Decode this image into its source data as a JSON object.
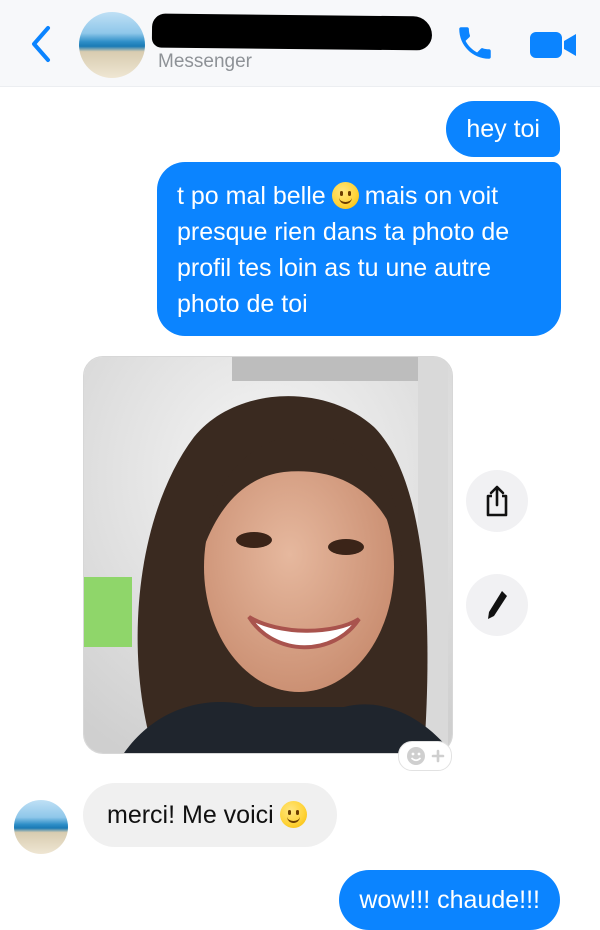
{
  "header": {
    "contact_name": "",
    "subtitle": "Messenger",
    "icons": [
      "chevron-left-icon",
      "phone-icon",
      "video-camera-icon"
    ]
  },
  "messages": [
    {
      "side": "outgoing",
      "text": "hey toi"
    },
    {
      "side": "outgoing",
      "parts": [
        "t po mal belle",
        "mais on voit presque rien dans ta photo de profil tes loin as tu une autre photo de toi"
      ]
    },
    {
      "side": "incoming",
      "type": "image"
    },
    {
      "side": "incoming",
      "text": "merci! Me voici"
    },
    {
      "side": "outgoing",
      "text": "wow!!! chaude!!!"
    }
  ],
  "actions": {
    "share_icon": "share-icon",
    "edit_icon": "pencil-icon",
    "react_icon": "add-reaction-icon"
  },
  "colors": {
    "accent": "#0b84ff",
    "incoming_bubble": "#f0f0f0",
    "header_bg": "#f7f8fa"
  }
}
